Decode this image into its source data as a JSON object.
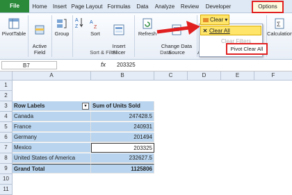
{
  "tabs": [
    "File",
    "Home",
    "Insert",
    "Page Layout",
    "Formulas",
    "Data",
    "Analyze",
    "Review",
    "Developer",
    "Options"
  ],
  "ribbon": {
    "pivottable": "PivotTable",
    "active_field": "Active\nField",
    "group": "Group",
    "sort": "Sort",
    "insert_slicer": "Insert\nSlicer",
    "refresh": "Refresh",
    "change_data_source": "Change Data\nSource",
    "calculations": "Calculations",
    "group_sort_filter": "Sort & Filter",
    "group_data": "Data",
    "group_actions_partial": "Ac",
    "clear_button": "Clear",
    "clear_all": "Clear All",
    "clear_filters": "Clear Filters",
    "tooltip": "Pivot Clear All"
  },
  "formula_bar": {
    "name_box": "B7",
    "fx": "fx",
    "value": "203325"
  },
  "columns": [
    "A",
    "B",
    "C",
    "D",
    "E",
    "F"
  ],
  "rows": [
    "1",
    "2",
    "3",
    "4",
    "5",
    "6",
    "7",
    "8",
    "9",
    "10",
    "11"
  ],
  "pivot": {
    "headers": [
      "Row Labels",
      "Sum of Units Sold"
    ],
    "records": [
      {
        "label": "Canada",
        "value": "247428.5"
      },
      {
        "label": "France",
        "value": "240931"
      },
      {
        "label": "Germany",
        "value": "201494"
      },
      {
        "label": "Mexico",
        "value": "203325"
      },
      {
        "label": "United States of America",
        "value": "232627.5"
      }
    ],
    "total_label": "Grand Total",
    "total_value": "1125806"
  },
  "colors": {
    "file_tab": "#2a8a3a",
    "highlight_red": "#e02020",
    "pivot_fill": "#b8d4ee",
    "clear_button": "#ffe66a"
  }
}
